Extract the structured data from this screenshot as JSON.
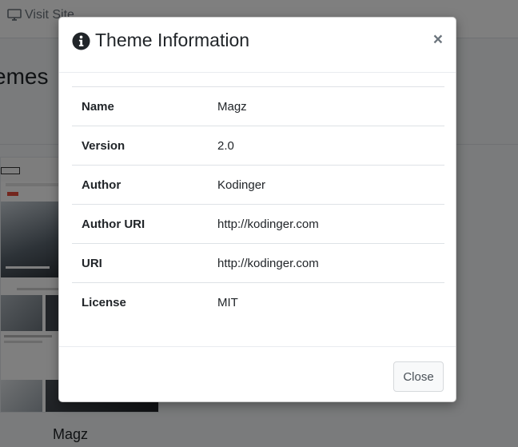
{
  "background": {
    "visit_site_label": "Visit Site",
    "heading": "emes",
    "theme_card_title": "Magz"
  },
  "modal": {
    "title": "Theme Information",
    "close_icon": "×",
    "rows": [
      {
        "label": "Name",
        "value": "Magz"
      },
      {
        "label": "Version",
        "value": "2.0"
      },
      {
        "label": "Author",
        "value": "Kodinger"
      },
      {
        "label": "Author URI",
        "value": "http://kodinger.com"
      },
      {
        "label": "URI",
        "value": "http://kodinger.com"
      },
      {
        "label": "License",
        "value": "MIT"
      }
    ],
    "close_button_label": "Close"
  },
  "icons": {
    "header": "info-circle-icon",
    "visit": "monitor-icon"
  },
  "colors": {
    "backdrop": "#000000",
    "text": "#212529",
    "muted": "#6c757d"
  }
}
